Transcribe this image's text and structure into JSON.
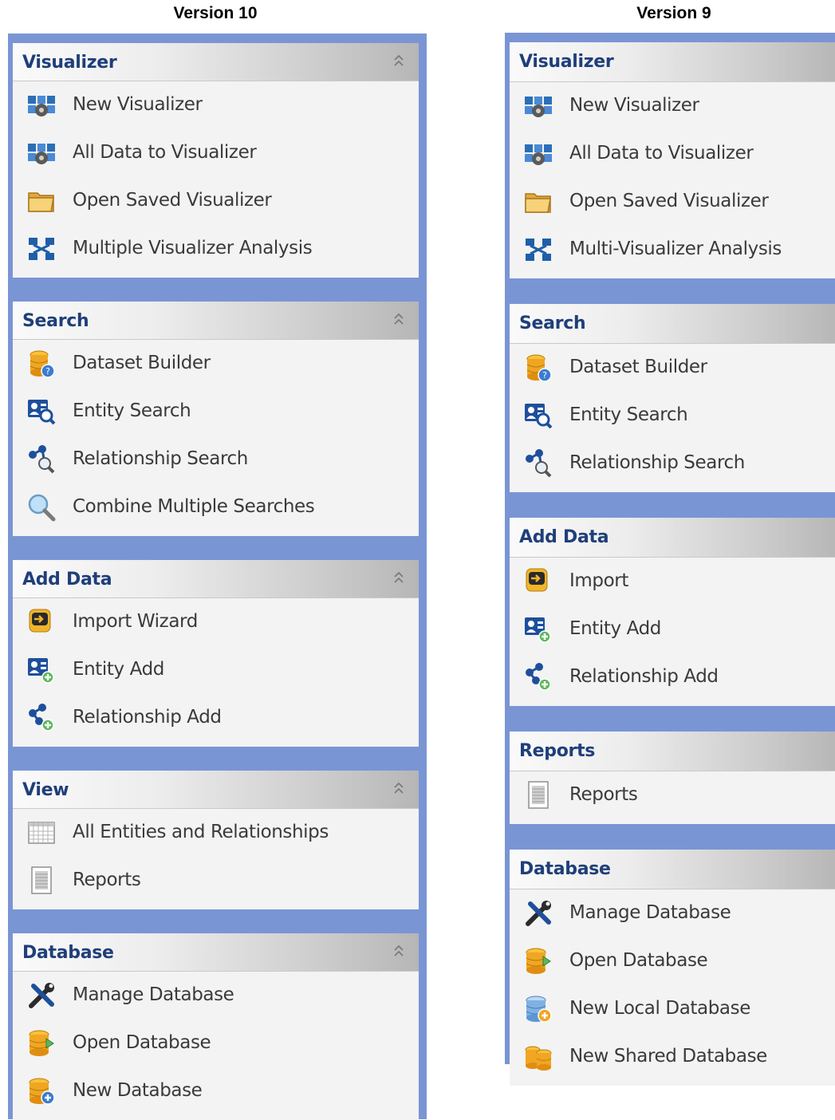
{
  "columns": [
    {
      "title": "Version 10",
      "groups": [
        {
          "title": "Visualizer",
          "collapsible": true,
          "items": [
            {
              "label": "New Visualizer",
              "icon": "visualizer-icon"
            },
            {
              "label": "All Data to Visualizer",
              "icon": "visualizer-icon"
            },
            {
              "label": "Open Saved Visualizer",
              "icon": "folder-icon"
            },
            {
              "label": "Multiple Visualizer Analysis",
              "icon": "multi-visualizer-icon"
            }
          ]
        },
        {
          "title": "Search",
          "collapsible": true,
          "items": [
            {
              "label": "Dataset Builder",
              "icon": "dataset-builder-icon"
            },
            {
              "label": "Entity Search",
              "icon": "entity-search-icon"
            },
            {
              "label": "Relationship Search",
              "icon": "relationship-search-icon"
            },
            {
              "label": "Combine Multiple Searches",
              "icon": "magnifier-icon"
            }
          ]
        },
        {
          "title": "Add Data",
          "collapsible": true,
          "items": [
            {
              "label": "Import Wizard",
              "icon": "import-icon"
            },
            {
              "label": "Entity Add",
              "icon": "entity-add-icon"
            },
            {
              "label": "Relationship  Add",
              "icon": "relationship-add-icon"
            }
          ]
        },
        {
          "title": "View",
          "collapsible": true,
          "items": [
            {
              "label": "All Entities and Relationships",
              "icon": "grid-icon"
            },
            {
              "label": "Reports",
              "icon": "report-icon"
            }
          ]
        },
        {
          "title": "Database",
          "collapsible": true,
          "items": [
            {
              "label": "Manage Database",
              "icon": "tools-icon"
            },
            {
              "label": "Open Database",
              "icon": "open-database-icon"
            },
            {
              "label": "New Database",
              "icon": "new-database-icon"
            }
          ]
        }
      ]
    },
    {
      "title": "Version 9",
      "groups": [
        {
          "title": "Visualizer",
          "collapsible": false,
          "items": [
            {
              "label": "New Visualizer",
              "icon": "visualizer-icon"
            },
            {
              "label": "All Data to Visualizer",
              "icon": "visualizer-icon"
            },
            {
              "label": "Open Saved Visualizer",
              "icon": "folder-icon"
            },
            {
              "label": "Multi-Visualizer Analysis",
              "icon": "multi-visualizer-icon"
            }
          ]
        },
        {
          "title": "Search",
          "collapsible": false,
          "items": [
            {
              "label": "Dataset Builder",
              "icon": "dataset-builder-icon"
            },
            {
              "label": "Entity Search",
              "icon": "entity-search-icon"
            },
            {
              "label": "Relationship Search",
              "icon": "relationship-search-icon"
            }
          ]
        },
        {
          "title": "Add Data",
          "collapsible": false,
          "items": [
            {
              "label": "Import",
              "icon": "import-icon"
            },
            {
              "label": "Entity Add",
              "icon": "entity-add-icon"
            },
            {
              "label": "Relationship  Add",
              "icon": "relationship-add-icon"
            }
          ]
        },
        {
          "title": "Reports",
          "collapsible": false,
          "items": [
            {
              "label": "Reports",
              "icon": "report-icon"
            }
          ]
        },
        {
          "title": "Database",
          "collapsible": false,
          "items": [
            {
              "label": "Manage Database",
              "icon": "tools-icon"
            },
            {
              "label": "Open Database",
              "icon": "open-database-icon"
            },
            {
              "label": "New Local Database",
              "icon": "new-local-database-icon"
            },
            {
              "label": "New Shared Database",
              "icon": "new-shared-database-icon"
            }
          ]
        }
      ]
    }
  ],
  "colors": {
    "panel_background": "#7a95d4",
    "group_title": "#1f3f7a",
    "item_text": "#3a3a3a"
  }
}
